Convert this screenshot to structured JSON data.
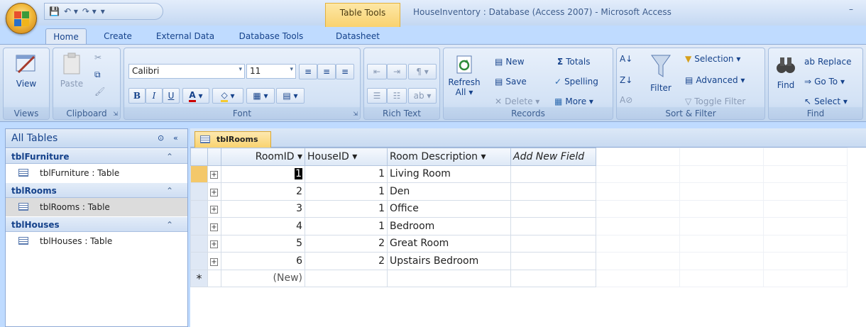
{
  "window": {
    "title": "HouseInventory : Database (Access 2007) - Microsoft Access",
    "contextual_tab_group": "Table Tools",
    "minimize": "–"
  },
  "ribbon_tabs": [
    {
      "label": "Home",
      "active": true
    },
    {
      "label": "Create"
    },
    {
      "label": "External Data"
    },
    {
      "label": "Database Tools"
    },
    {
      "label": "Datasheet"
    }
  ],
  "ribbon": {
    "views": {
      "label": "Views",
      "view": "View"
    },
    "clipboard": {
      "label": "Clipboard",
      "paste": "Paste"
    },
    "font": {
      "label": "Font",
      "font_name": "Calibri",
      "font_size": "11"
    },
    "rich_text": {
      "label": "Rich Text"
    },
    "records": {
      "label": "Records",
      "refresh": "Refresh",
      "refresh_sub": "All ▾",
      "new": "New",
      "save": "Save",
      "delete": "Delete ▾",
      "totals": "Totals",
      "spelling": "Spelling",
      "more": "More ▾"
    },
    "sort_filter": {
      "label": "Sort & Filter",
      "filter": "Filter",
      "selection": "Selection ▾",
      "advanced": "Advanced ▾",
      "toggle_filter": "Toggle Filter"
    },
    "find": {
      "label": "Find",
      "find": "Find",
      "replace": "Replace",
      "goto": "Go To ▾",
      "select": "Select ▾"
    }
  },
  "nav_pane": {
    "title": "All Tables",
    "groups": [
      {
        "name": "tblFurniture",
        "item": "tblFurniture : Table"
      },
      {
        "name": "tblRooms",
        "item": "tblRooms : Table"
      },
      {
        "name": "tblHouses",
        "item": "tblHouses : Table"
      }
    ]
  },
  "datasheet": {
    "tab": "tblRooms",
    "columns": [
      "RoomID",
      "HouseID",
      "Room Description",
      "Add New Field"
    ],
    "rows": [
      {
        "room_id": "1",
        "house_id": "1",
        "desc": "Living Room"
      },
      {
        "room_id": "2",
        "house_id": "1",
        "desc": "Den"
      },
      {
        "room_id": "3",
        "house_id": "1",
        "desc": "Office"
      },
      {
        "room_id": "4",
        "house_id": "1",
        "desc": "Bedroom"
      },
      {
        "room_id": "5",
        "house_id": "2",
        "desc": "Great Room"
      },
      {
        "room_id": "6",
        "house_id": "2",
        "desc": "Upstairs Bedroom"
      }
    ],
    "new_row_label": "(New)",
    "new_row_marker": "*"
  }
}
